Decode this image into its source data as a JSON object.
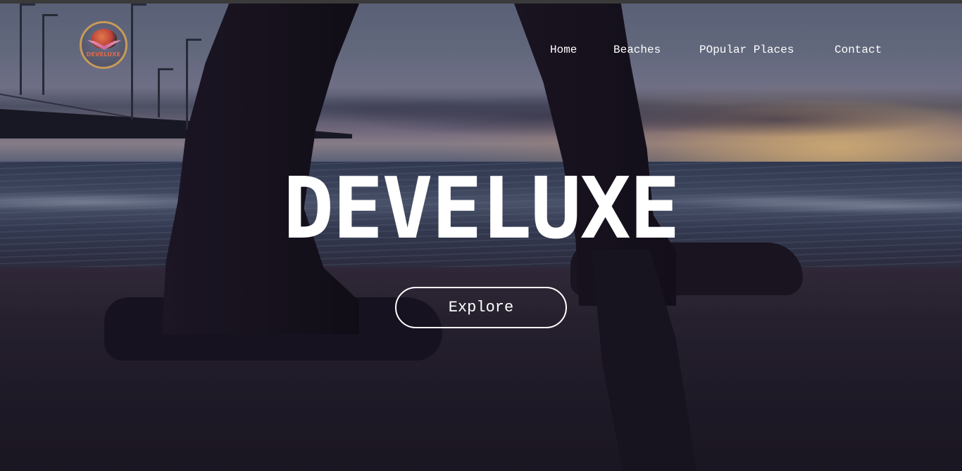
{
  "logo": {
    "text": "DEVELUXE",
    "ring_color": "#c79a5a",
    "text_color": "#e0684a"
  },
  "nav": {
    "items": [
      {
        "label": "Home"
      },
      {
        "label": "Beaches"
      },
      {
        "label": "POpular Places"
      },
      {
        "label": "Contact"
      }
    ],
    "text_color": "#ffffff"
  },
  "hero": {
    "title": "DEVELUXE",
    "button_label": "Explore",
    "background_image": "beach-sunset-walking-feet"
  }
}
